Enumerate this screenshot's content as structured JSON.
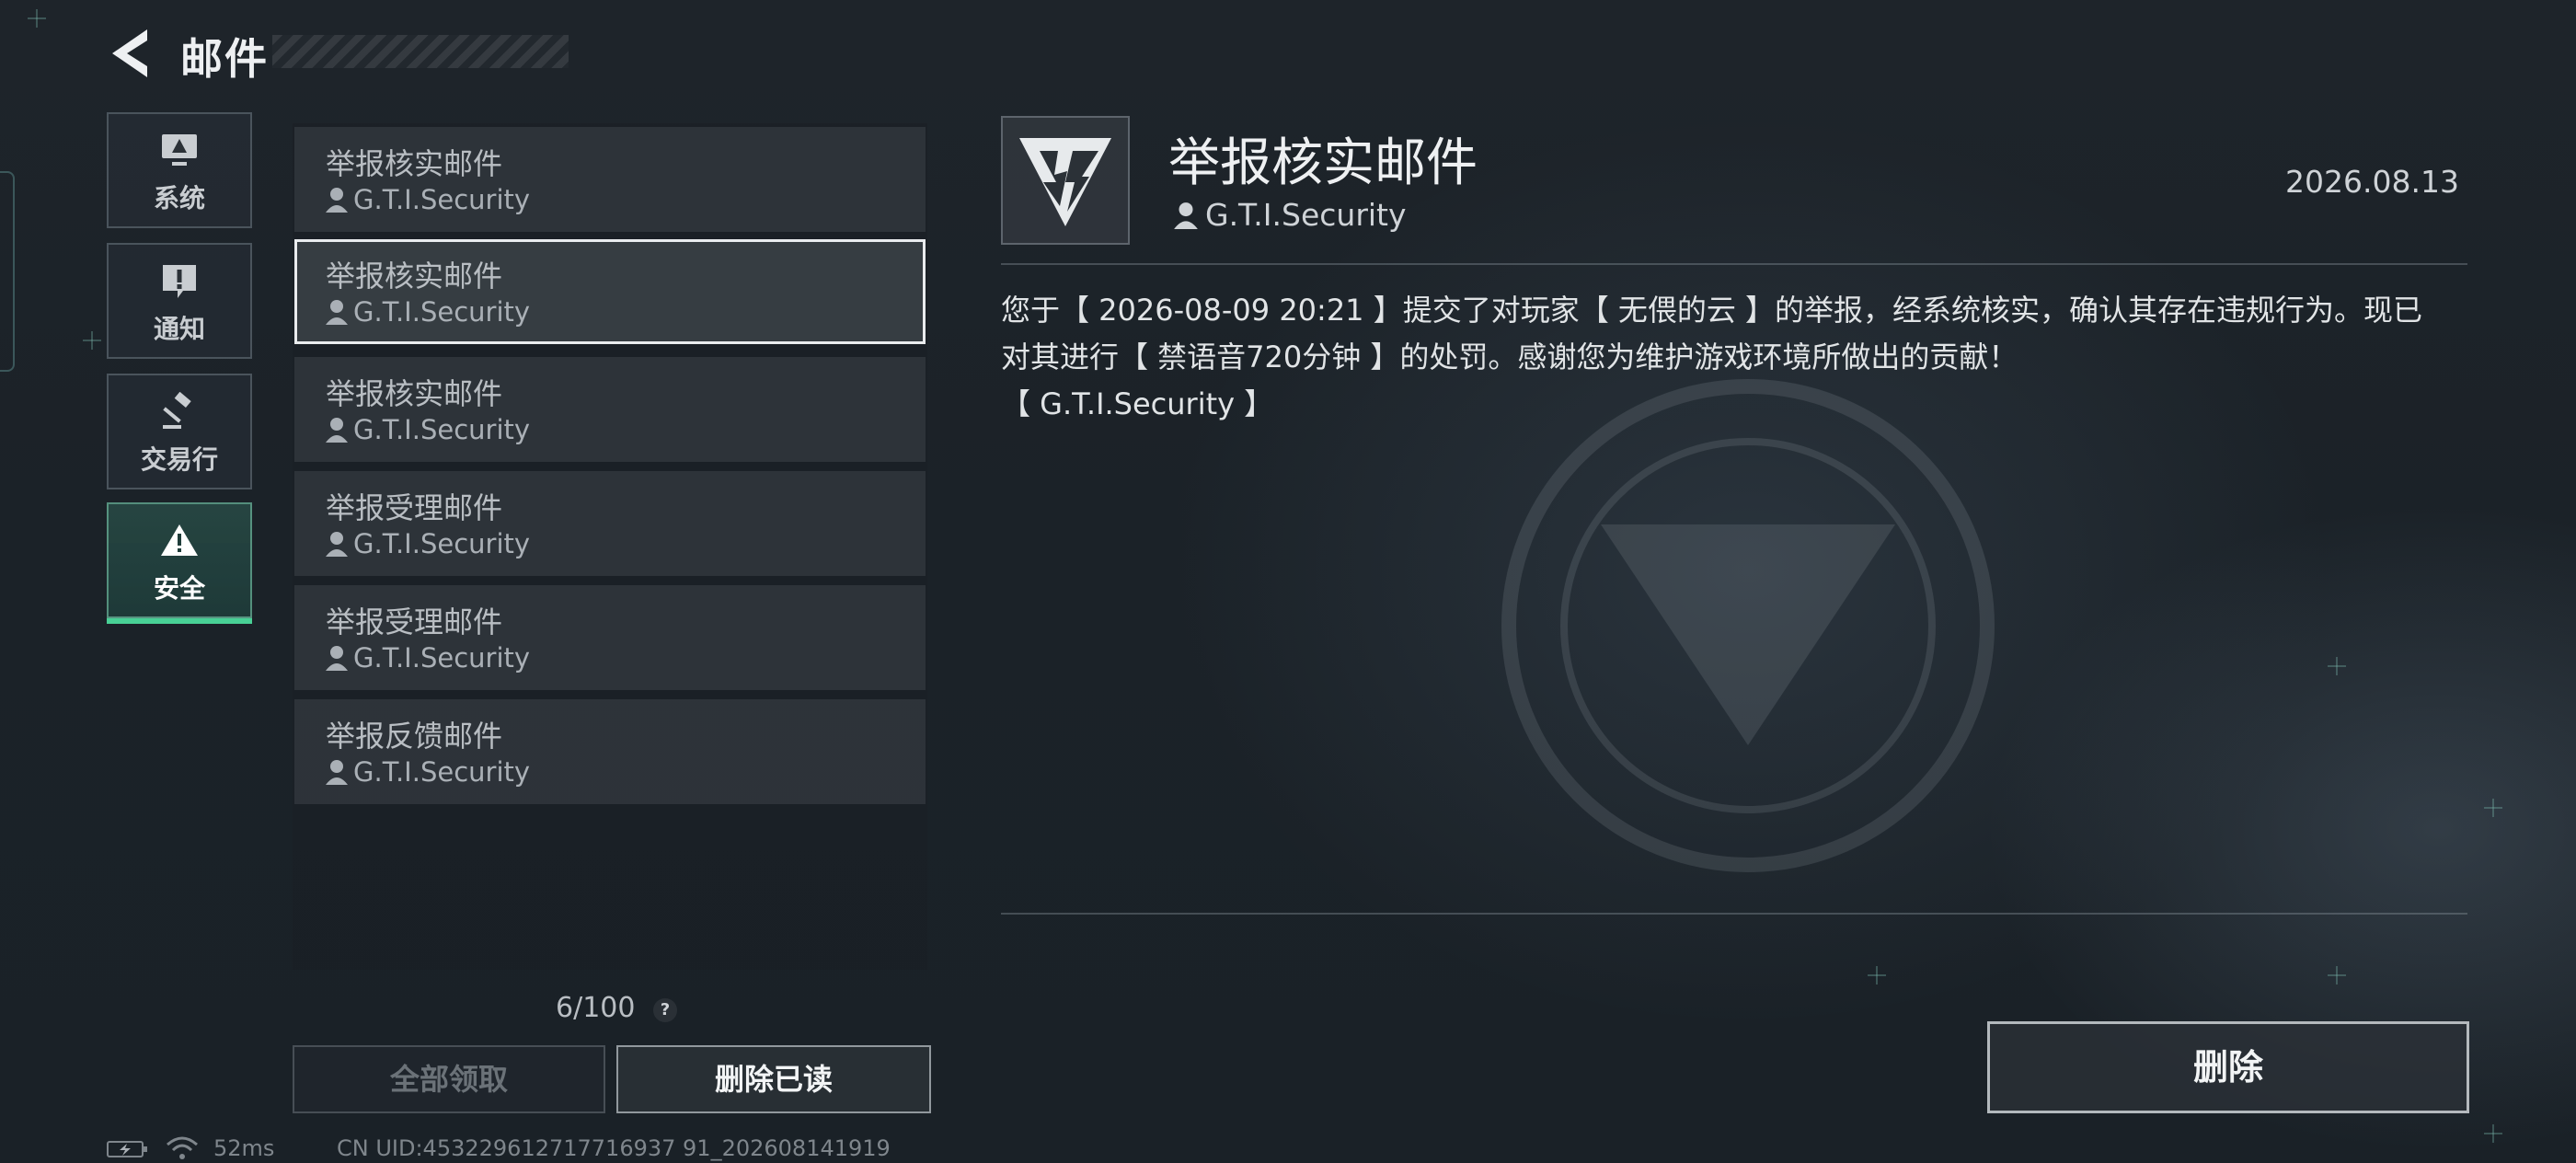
{
  "header": {
    "title": "邮件"
  },
  "categories": [
    {
      "label": "系统",
      "icon": "monitor-icon"
    },
    {
      "label": "通知",
      "icon": "exclamation-icon"
    },
    {
      "label": "交易行",
      "icon": "gavel-icon"
    },
    {
      "label": "安全",
      "icon": "warning-icon",
      "active": true
    }
  ],
  "mails": [
    {
      "subject": "举报核实邮件",
      "sender": "G.T.I.Security"
    },
    {
      "subject": "举报核实邮件",
      "sender": "G.T.I.Security",
      "selected": true
    },
    {
      "subject": "举报核实邮件",
      "sender": "G.T.I.Security"
    },
    {
      "subject": "举报受理邮件",
      "sender": "G.T.I.Security"
    },
    {
      "subject": "举报受理邮件",
      "sender": "G.T.I.Security"
    },
    {
      "subject": "举报反馈邮件",
      "sender": "G.T.I.Security"
    }
  ],
  "list_footer": {
    "count": "6/100",
    "help": "?",
    "claim_all_label": "全部领取",
    "delete_read_label": "删除已读"
  },
  "status_bar": {
    "ping": "52ms",
    "uid": "CN UID:453229612717716937 91_202608141919"
  },
  "detail": {
    "subject": "举报核实邮件",
    "sender": "G.T.I.Security",
    "date": "2026.08.13",
    "body": "您于【 2026-08-09 20:21 】提交了对玩家【 无偎的云 】的举报，经系统核实，确认其存在违规行为。现已\n对其进行【 禁语音720分钟 】的处罚。感谢您为维护游戏环境所做出的贡献！\n【 G.T.I.Security 】",
    "delete_label": "删除"
  },
  "colors": {
    "accent": "#48d095",
    "background": "#1c2329"
  }
}
